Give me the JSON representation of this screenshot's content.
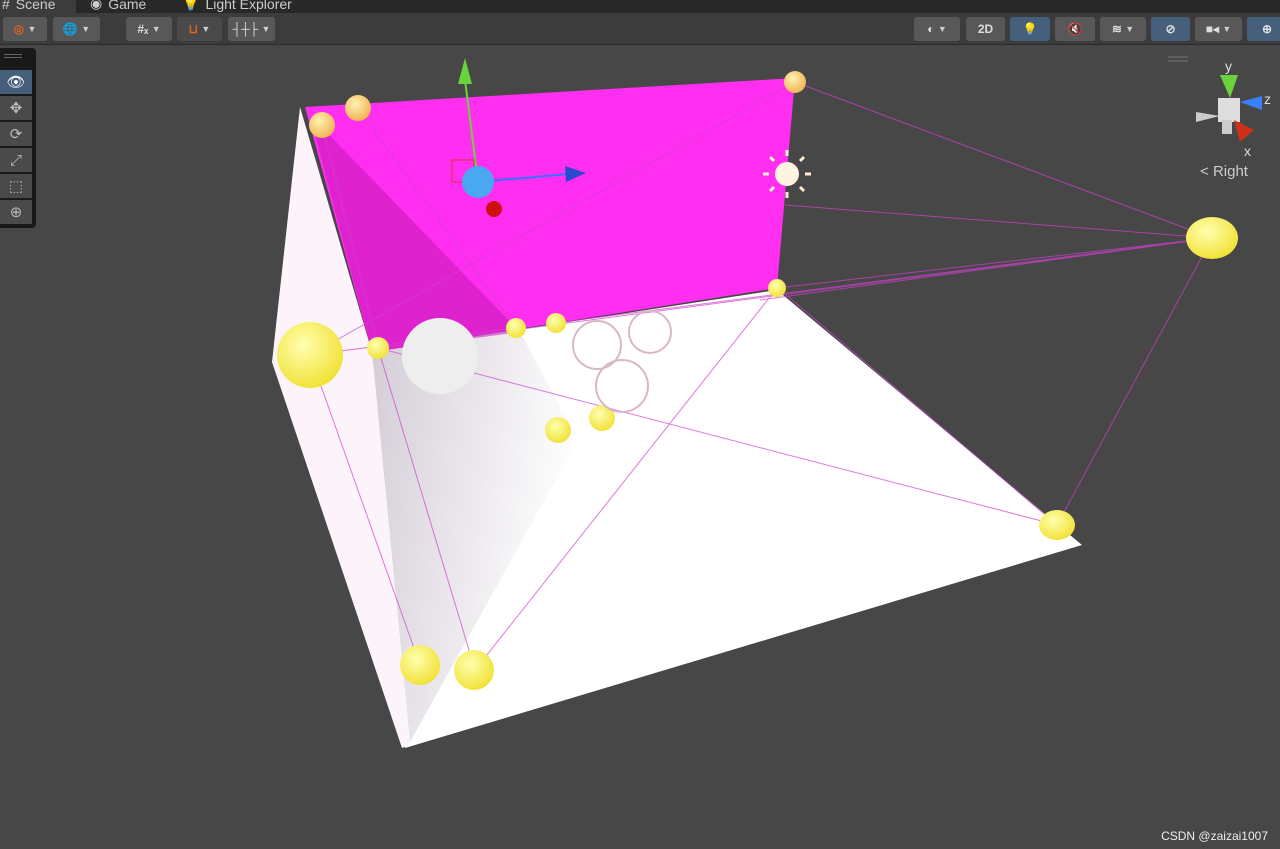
{
  "tabs": [
    {
      "label": "Scene",
      "icon": "hash-icon"
    },
    {
      "label": "Game",
      "icon": "gamepad-icon"
    },
    {
      "label": "Light Explorer",
      "icon": "bulb-icon"
    }
  ],
  "toolbar": {
    "mode_2d": "2D"
  },
  "tools": [
    "view",
    "move",
    "rotate",
    "scale",
    "rect",
    "transform"
  ],
  "gizmo": {
    "y": "y",
    "z": "z",
    "x": "x",
    "view_label": "Right"
  },
  "watermark": "CSDN @zaizai1007",
  "colors": {
    "wall": "#ff2ef0",
    "floor": "#ffffff",
    "probe": "#ffff66",
    "accent": "#46607c"
  }
}
